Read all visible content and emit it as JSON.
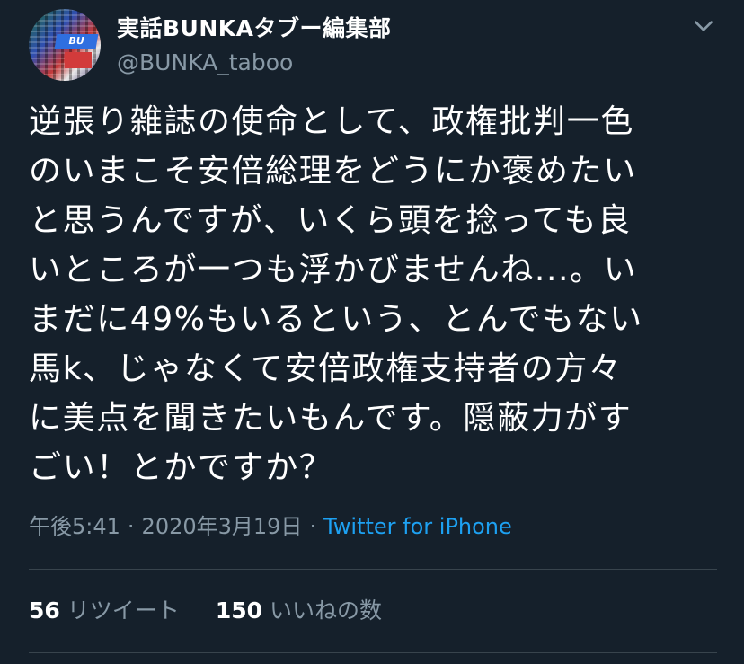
{
  "account": {
    "display_name": "実話BUNKAタブー編集部",
    "handle": "@BUNKA_taboo",
    "avatar_mast_text": "BU"
  },
  "tweet": {
    "text": "逆張り雑誌の使命として、政権批判一色\nのいまこそ安倍総理をどうにか褒めたい\nと思うんですが、いくら頭を捻っても良\nいところが一つも浮かびませんね...。い\nまだに49%もいるという、とんでもない\n馬k、じゃなくて安倍政権支持者の方々\nに美点を聞きたいもんです。隠蔽力がす\nごい！とかですか？",
    "time": "午後5:41",
    "date": "2020年3月19日",
    "source": "Twitter for iPhone"
  },
  "stats": {
    "retweets_count": "56",
    "retweets_label": "リツイート",
    "likes_count": "150",
    "likes_label": "いいねの数"
  },
  "colors": {
    "background": "#15202b",
    "primary_text": "#ffffff",
    "secondary_text": "#8899a6",
    "link": "#1da1f2",
    "divider": "#38444d"
  },
  "icons": {
    "menu": "chevron-down-icon"
  }
}
